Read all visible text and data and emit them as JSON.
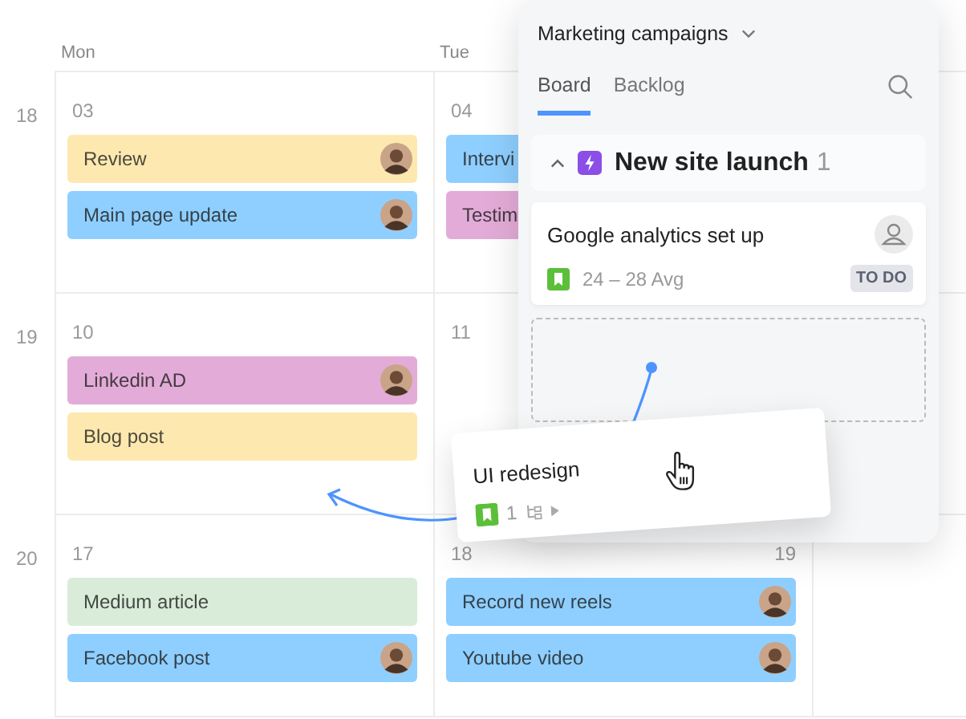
{
  "calendar": {
    "weekdays": [
      "Mon",
      "Tue"
    ],
    "weeks": [
      {
        "number": "18",
        "days": [
          {
            "date": "03",
            "events": [
              {
                "title": "Review",
                "color": "#fde9b0",
                "avatar": true
              },
              {
                "title": "Main page update",
                "color": "#8fcfff",
                "avatar": true
              }
            ]
          },
          {
            "date": "04",
            "events": [
              {
                "title": "Intervi",
                "color": "#8fcfff"
              },
              {
                "title": "Testim",
                "color": "#e3acd8"
              }
            ]
          }
        ]
      },
      {
        "number": "19",
        "days": [
          {
            "date": "10",
            "events": [
              {
                "title": "Linkedin AD",
                "color": "#e3acd8",
                "avatar": true
              },
              {
                "title": "Blog post",
                "color": "#fde9b0",
                "avatar": false
              }
            ]
          },
          {
            "date": "11"
          }
        ]
      },
      {
        "number": "20",
        "days": [
          {
            "date": "17",
            "events": [
              {
                "title": "Medium article",
                "color": "#d9ecd9",
                "avatar": false
              },
              {
                "title": "Facebook post",
                "color": "#8fcfff",
                "avatar": true
              }
            ]
          },
          {
            "date": "18",
            "next_date": "19",
            "events": [
              {
                "title": "Record new reels",
                "color": "#8fcfff",
                "avatar": true
              },
              {
                "title": "Youtube video",
                "color": "#8fcfff",
                "avatar": true
              }
            ]
          }
        ]
      }
    ]
  },
  "panel": {
    "project": "Marketing campaigns",
    "tabs": [
      {
        "label": "Board",
        "selected": true
      },
      {
        "label": "Backlog",
        "selected": false
      }
    ],
    "group": {
      "title": "New site launch",
      "count": "1",
      "expanded": true
    },
    "task": {
      "title": "Google analytics set up",
      "dates": "24 – 28 Avg",
      "status": "TO DO"
    }
  },
  "dragged_card": {
    "title": "UI redesign",
    "subtasks": "1"
  }
}
